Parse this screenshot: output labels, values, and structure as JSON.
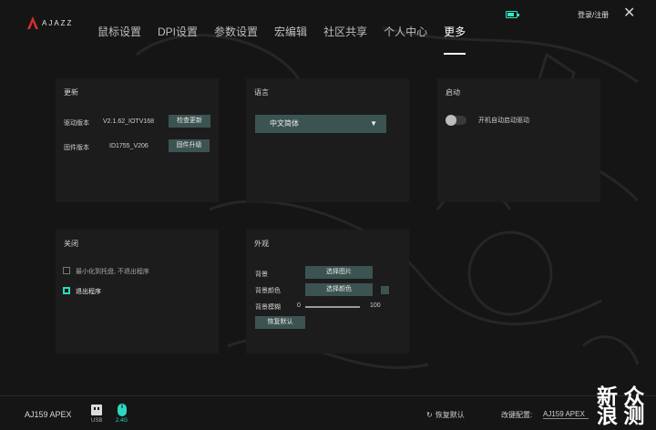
{
  "brand": {
    "logo_text": "AJAZZ"
  },
  "header": {
    "nav": [
      "鼠标设置",
      "DPI设置",
      "参数设置",
      "宏编辑",
      "社区共享",
      "个人中心",
      "更多"
    ],
    "active_tab": "更多",
    "login_label": "登录/注册",
    "close_glyph": "✕"
  },
  "update_panel": {
    "title": "更新",
    "driver_label": "驱动版本",
    "driver_value": "V2.1.62_IOTV168",
    "driver_button": "检查更新",
    "firmware_label": "固件版本",
    "firmware_value": "ID1755_V206",
    "firmware_button": "固件升级"
  },
  "language_panel": {
    "title": "语言",
    "selected": "中文简体",
    "arrow": "▼"
  },
  "startup_panel": {
    "title": "启动",
    "toggle_label": "开机自动启动驱动",
    "toggle_on": false
  },
  "close_panel": {
    "title": "关闭",
    "option1_label": "最小化到托盘, 不退出程序",
    "option1_checked": false,
    "option2_label": "退出程序",
    "option2_checked": true
  },
  "appearance_panel": {
    "title": "外观",
    "background_label": "背景",
    "background_button": "选择图片",
    "bgcolor_label": "背景颜色",
    "bgcolor_button": "选择颜色",
    "blur_label": "背景模糊",
    "blur_min": "0",
    "blur_max": "100",
    "reset_button": "恢复默认"
  },
  "footer": {
    "device_name": "AJ159 APEX",
    "usb_label": "USB",
    "wireless_label": "2.4G",
    "restore_label": "恢复默认",
    "config_label": "改键配置:",
    "config_value": "AJ159 APEX"
  },
  "watermark": {
    "line1": "新 众",
    "line2": "浪 测"
  },
  "colors": {
    "accent": "#2fd6c2",
    "button": "#3c5451",
    "panel": "#1c1c1c",
    "background": "#151515"
  }
}
